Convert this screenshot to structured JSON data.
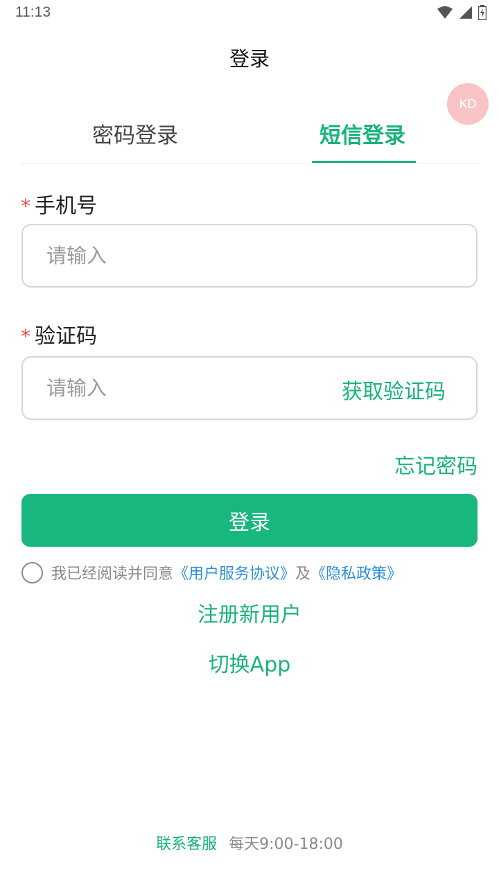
{
  "status_bar": {
    "time": "11:13",
    "icons": [
      "wifi-icon",
      "signal-icon",
      "battery-icon"
    ]
  },
  "header": {
    "title": "登录",
    "avatar_text": "KD"
  },
  "tabs": [
    {
      "label": "密码登录",
      "active": false
    },
    {
      "label": "短信登录",
      "active": true
    }
  ],
  "form": {
    "required_mark": "*",
    "phone": {
      "label": "手机号",
      "placeholder": "请输入",
      "value": ""
    },
    "code": {
      "label": "验证码",
      "placeholder": "请输入",
      "value": "",
      "get_code_label": "获取验证码"
    },
    "forgot_label": "忘记密码",
    "submit_label": "登录"
  },
  "agreement": {
    "checked": false,
    "prefix": "我已经阅读并同意",
    "terms_link": "《用户服务协议》",
    "conjunction": "及",
    "privacy_link": "《隐私政策》"
  },
  "register_label": "注册新用户",
  "switch_app_label": "切换App",
  "footer": {
    "contact_label": "联系客服",
    "hours": "每天9:00-18:00"
  },
  "colors": {
    "accent": "#19b27e",
    "button": "#18b77e",
    "link_blue": "#2e8fd8",
    "required": "#f04b4b",
    "avatar_bg": "#f7c5c5"
  }
}
